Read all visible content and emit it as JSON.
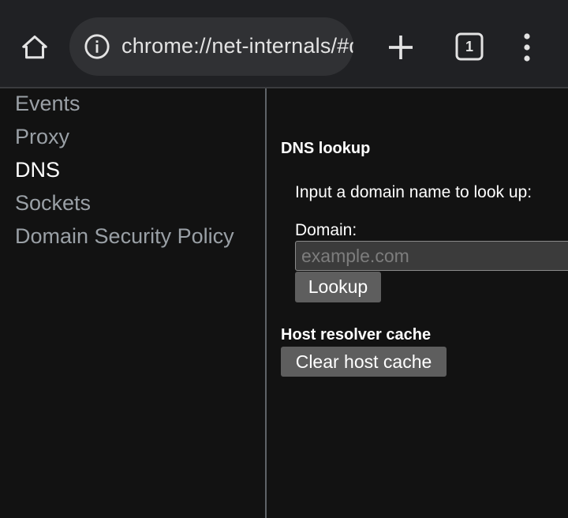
{
  "browser": {
    "url": "chrome://net-internals/#dns",
    "tab_count": "1",
    "icons": {
      "home": "home-icon",
      "site_info": "info-icon",
      "new_tab": "plus-icon",
      "tab_switcher": "tab-switcher-icon",
      "menu": "more-vert-icon"
    }
  },
  "sidebar": {
    "items": [
      {
        "label": "Events",
        "active": false
      },
      {
        "label": "Proxy",
        "active": false
      },
      {
        "label": "DNS",
        "active": true
      },
      {
        "label": "Sockets",
        "active": false
      },
      {
        "label": "Domain Security Policy",
        "active": false
      }
    ]
  },
  "dns_lookup": {
    "heading": "DNS lookup",
    "prompt": "Input a domain name to look up:",
    "domain_label": "Domain:",
    "domain_value": "",
    "domain_placeholder": "example.com",
    "lookup_button": "Lookup"
  },
  "host_cache": {
    "heading": "Host resolver cache",
    "clear_button": "Clear host cache"
  },
  "colors": {
    "toolbar_bg": "#202124",
    "omnibox_bg": "#303134",
    "page_bg": "#121212",
    "inactive_text": "#9aa0a6",
    "active_text": "#ffffff",
    "button_bg": "#5e5e5e"
  }
}
